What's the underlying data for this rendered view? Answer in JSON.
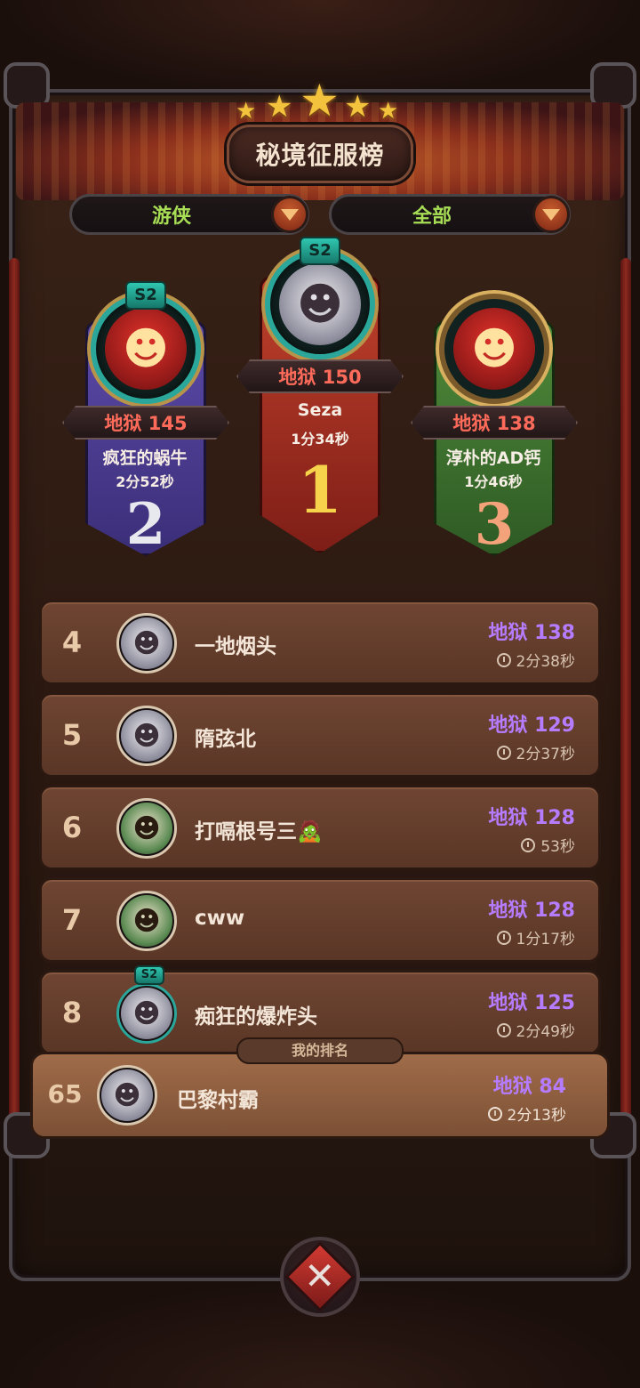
{
  "header": {
    "title": "秘境征服榜",
    "stars_count": 5
  },
  "filters": [
    {
      "label": "游侠"
    },
    {
      "label": "全部"
    }
  ],
  "podium": {
    "first": {
      "rank": "1",
      "badge": "S2",
      "score": "地狱 150",
      "name": "Seza",
      "time": "1分34秒"
    },
    "second": {
      "rank": "2",
      "badge": "S2",
      "score": "地狱 145",
      "name": "疯狂的蜗牛",
      "time": "2分52秒"
    },
    "third": {
      "rank": "3",
      "score": "地狱 138",
      "name": "淳朴的AD钙",
      "time": "1分46秒"
    }
  },
  "list": [
    {
      "rank": "4",
      "name": "一地烟头",
      "score": "地狱 138",
      "time": "2分38秒"
    },
    {
      "rank": "5",
      "name": "隋弦北",
      "score": "地狱 129",
      "time": "2分37秒"
    },
    {
      "rank": "6",
      "name": "打嗝根号三🧟",
      "score": "地狱 128",
      "time": "53秒"
    },
    {
      "rank": "7",
      "name": "cww",
      "score": "地狱 128",
      "time": "1分17秒"
    },
    {
      "rank": "8",
      "badge": "S2",
      "name": "痴狂的爆炸头",
      "score": "地狱 125",
      "time": "2分49秒"
    }
  ],
  "my_rank": {
    "tag": "我的排名",
    "rank": "65",
    "name": "巴黎村霸",
    "score": "地狱 84",
    "time": "2分13秒"
  },
  "colors": {
    "score_purple": "#b57cff",
    "filter_green": "#a8de55",
    "rank2_purple": "#5c4aa8",
    "rank1_red": "#c0402b",
    "rank3_green": "#4f8a3a"
  },
  "icons": {
    "close": "close-x-icon",
    "clock": "clock-icon",
    "dropdown": "chevron-down-icon"
  }
}
